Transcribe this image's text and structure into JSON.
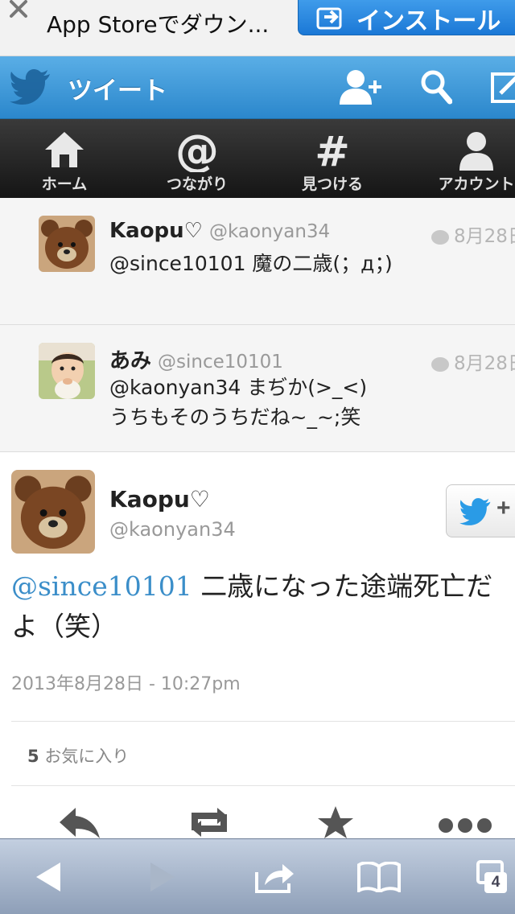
{
  "banner": {
    "title": "App Storeでダウン...",
    "install_label": "インストール"
  },
  "header": {
    "title": "ツイート",
    "icons": [
      "twitter-bird-icon",
      "add-user-icon",
      "search-icon",
      "compose-icon"
    ]
  },
  "nav": {
    "items": [
      {
        "label": "ホーム",
        "icon": "home-icon"
      },
      {
        "label": "つながり",
        "icon": "at-icon"
      },
      {
        "label": "見つける",
        "icon": "hashtag-icon"
      },
      {
        "label": "アカウント",
        "icon": "account-icon"
      }
    ]
  },
  "context_tweets": [
    {
      "name": "Kaopu♡",
      "handle": "@kaonyan34",
      "time": "8月28日",
      "lines": [
        "@since10101 魔の二歳(；д；)"
      ]
    },
    {
      "name": "あみ",
      "handle": "@since10101",
      "time": "8月28日",
      "lines": [
        "@kaonyan34 まぢか(>_<)",
        "うちもそのうちだね~_~;笑"
      ]
    }
  ],
  "main_tweet": {
    "name": "Kaopu♡",
    "handle": "@kaonyan34",
    "mention": "@since10101",
    "text": " 二歳になった途端死亡だよ（笑）",
    "date": "2013年8月28日 - 10:27pm",
    "fav_count": "5",
    "fav_label": "お気に入り",
    "follow_plus": "+"
  },
  "toolbar": {
    "tab_count": "4"
  },
  "colors": {
    "header_blue": "#2b87cc",
    "link_blue": "#3b8ec9"
  }
}
